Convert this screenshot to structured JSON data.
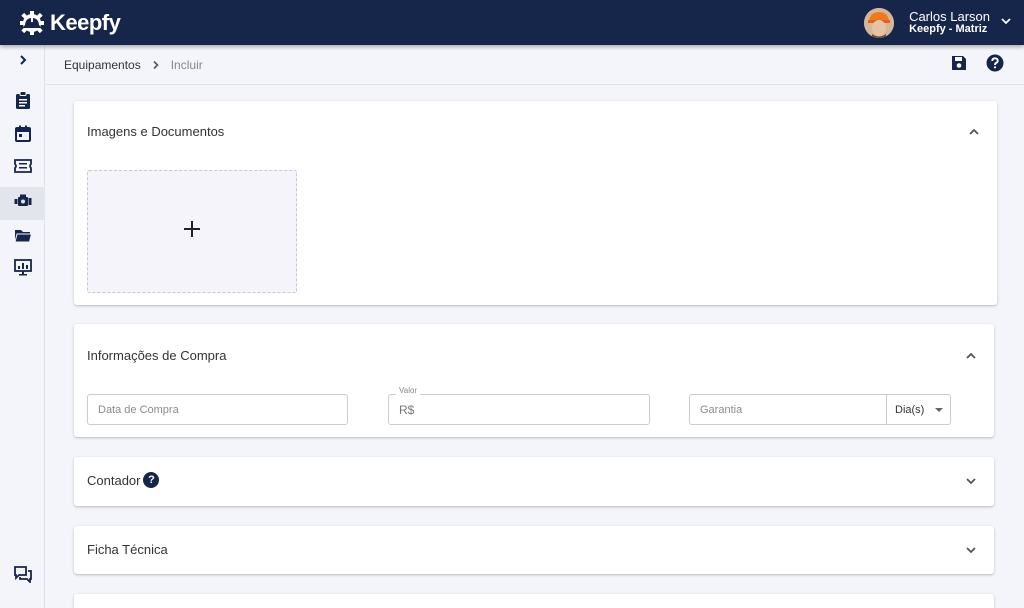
{
  "app": {
    "brand": "Keepfy",
    "colors": {
      "header": "#16254a",
      "accent": "#16254a",
      "background": "#f4f5fa"
    }
  },
  "user": {
    "name": "Carlos Larson",
    "org": "Keepfy - Matriz"
  },
  "sidebar": {
    "toggle_icon": "chevron-right-icon",
    "items": [
      {
        "icon": "clipboard-icon",
        "active": false
      },
      {
        "icon": "calendar-icon",
        "active": false
      },
      {
        "icon": "ticket-icon",
        "active": false
      },
      {
        "icon": "engine-icon",
        "active": true
      },
      {
        "icon": "folder-icon",
        "active": false
      },
      {
        "icon": "dashboard-monitor-icon",
        "active": false
      }
    ],
    "bottom_icon": "chat-icon"
  },
  "breadcrumb": {
    "parent": "Equipamentos",
    "current": "Incluir"
  },
  "toolbar": {
    "save_icon": "save-icon",
    "help_icon": "help-icon"
  },
  "sections": {
    "images": {
      "title": "Imagens e Documentos",
      "expanded": true
    },
    "purchase": {
      "title": "Informações de Compra",
      "expanded": true,
      "date_placeholder": "Data de Compra",
      "value_label": "Valor",
      "value_prefix": "R$",
      "warranty_placeholder": "Garantia",
      "warranty_unit": "Dia(s)"
    },
    "counter": {
      "title": "Contador",
      "help": "?",
      "expanded": false
    },
    "datasheet": {
      "title": "Ficha Técnica",
      "expanded": false
    }
  }
}
